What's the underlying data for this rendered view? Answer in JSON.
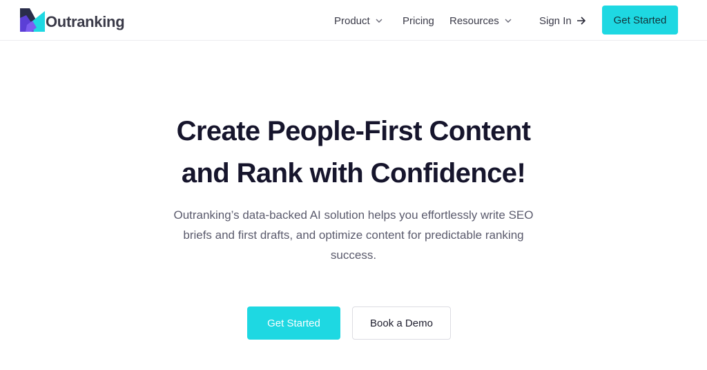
{
  "brand": {
    "name": "Outranking",
    "logo_icon": "outranking-logo-icon",
    "colors": {
      "accent": "#1ed8e2",
      "logo_purple": "#5b3fd6",
      "logo_teal": "#1ed8e2",
      "logo_dark": "#2a2d4a"
    }
  },
  "nav": {
    "product_label": "Product",
    "pricing_label": "Pricing",
    "resources_label": "Resources",
    "signin_label": "Sign In",
    "get_started_label": "Get Started"
  },
  "hero": {
    "title_line1": "Create People-First Content",
    "title_line2": "and Rank with Confidence!",
    "subtitle": "Outranking’s data-backed AI solution helps you effortlessly write SEO briefs and first drafts, and optimize content for predictable ranking success.",
    "primary_cta_label": "Get Started",
    "secondary_cta_label": "Book a Demo"
  }
}
